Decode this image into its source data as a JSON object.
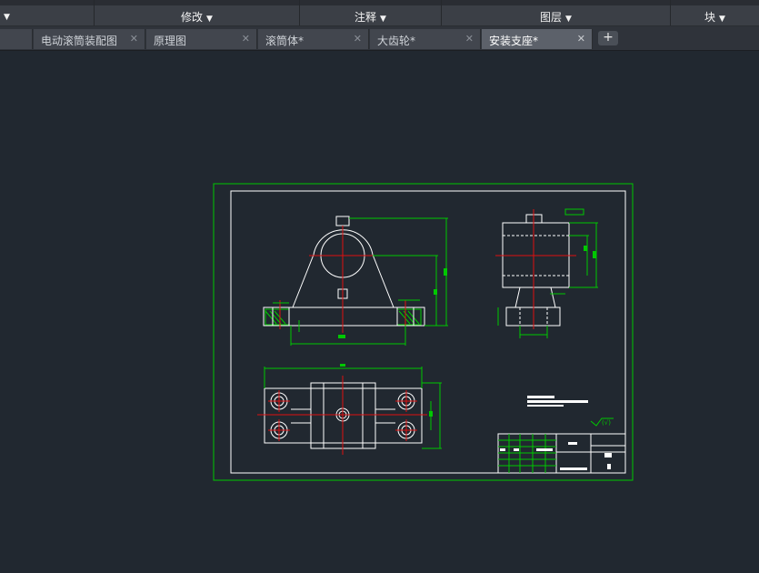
{
  "ribbon": {
    "panels": [
      {
        "label": "",
        "has_arrow": true
      },
      {
        "label": "修改",
        "has_arrow": true
      },
      {
        "label": "注释",
        "has_arrow": true
      },
      {
        "label": "图层",
        "has_arrow": true
      },
      {
        "label": "块",
        "has_arrow": true
      }
    ]
  },
  "tabs": [
    {
      "label": "电动滚筒装配图",
      "active": false
    },
    {
      "label": "原理图",
      "active": false
    },
    {
      "label": "滚筒体*",
      "active": false
    },
    {
      "label": "大齿轮*",
      "active": false
    },
    {
      "label": "安装支座*",
      "active": true
    }
  ],
  "add_tab_icon": "plus-icon",
  "close_icon": "close-icon",
  "colors": {
    "background": "#212830",
    "frame": "#00c800",
    "lines": "#ffffff",
    "centerline": "#e01010",
    "dimension": "#00c800"
  }
}
